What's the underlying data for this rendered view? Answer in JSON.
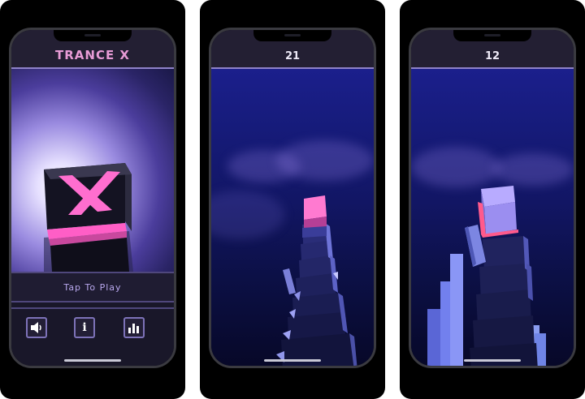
{
  "screens": [
    {
      "title": "TRANCE X",
      "block_symbol": "X",
      "tap_to_play": "Tap To Play",
      "buttons": [
        {
          "name": "sound",
          "icon": "speaker-icon"
        },
        {
          "name": "info",
          "icon": "info-icon",
          "glyph": "i"
        },
        {
          "name": "leaderboard",
          "icon": "bar-chart-icon"
        }
      ]
    },
    {
      "score": "21"
    },
    {
      "score": "12"
    }
  ],
  "colors": {
    "accent_pink": "#ff6ecf",
    "title_pink": "#e79bd6",
    "block_lavender": "#9b8ef0",
    "bar_border": "#8f82c9",
    "game_sky_top": "#1b1f8c"
  }
}
